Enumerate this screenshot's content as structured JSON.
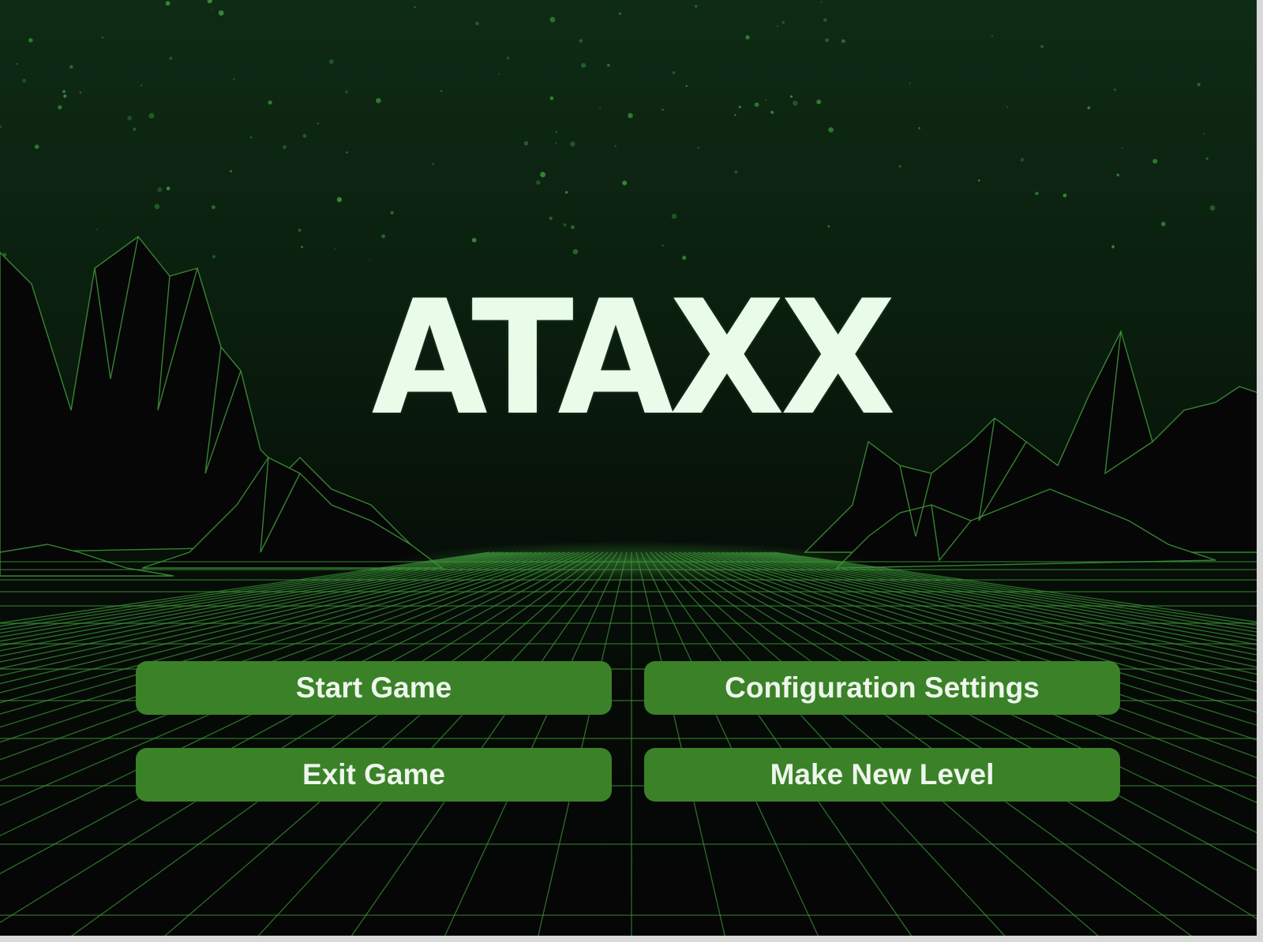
{
  "game": {
    "title": "ATAXX"
  },
  "menu": {
    "start_label": "Start Game",
    "config_label": "Configuration Settings",
    "exit_label": "Exit Game",
    "new_level_label": "Make New Level"
  },
  "colors": {
    "sky": "#0c2412",
    "ground": "#050505",
    "grid_line": "#3e9a3a",
    "button": "#3a8128",
    "title_text": "#e9fbe9"
  }
}
